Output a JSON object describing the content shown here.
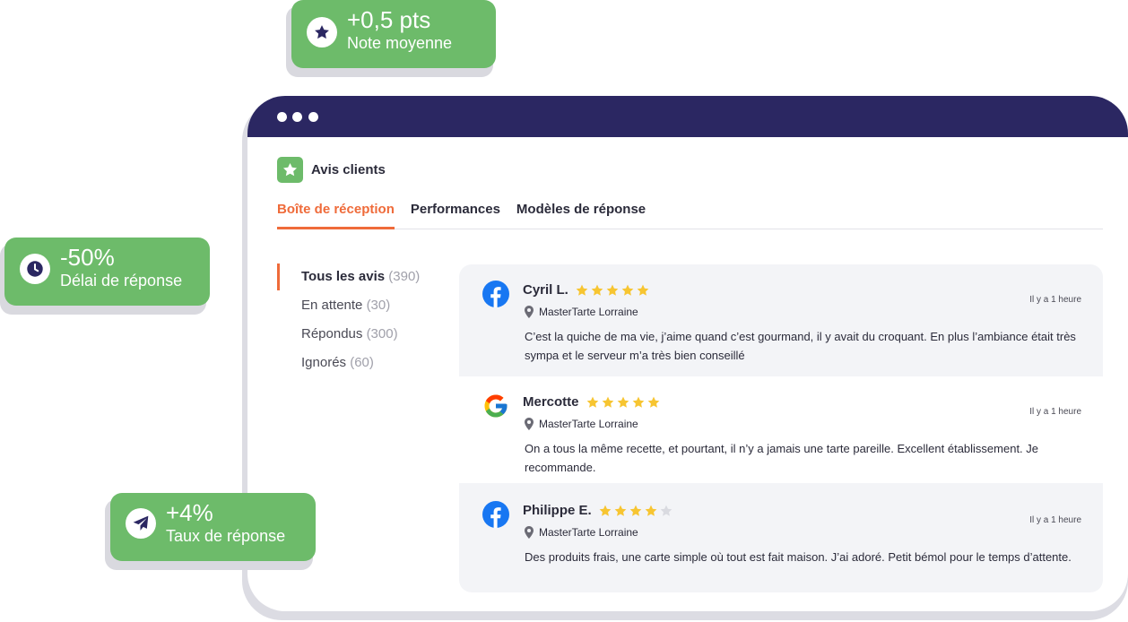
{
  "app": {
    "title": "Avis clients"
  },
  "tabs": [
    {
      "label": "Boîte de réception",
      "active": true
    },
    {
      "label": "Performances",
      "active": false
    },
    {
      "label": "Modèles de réponse",
      "active": false
    }
  ],
  "filters": [
    {
      "label": "Tous les avis",
      "count": "(390)",
      "active": true
    },
    {
      "label": "En attente",
      "count": "(30)",
      "active": false
    },
    {
      "label": "Répondus",
      "count": "(300)",
      "active": false
    },
    {
      "label": "Ignorés",
      "count": "(60)",
      "active": false
    }
  ],
  "reviews": [
    {
      "source": "facebook",
      "source_icon": "facebook-icon",
      "name": "Cyril L.",
      "rating": 5,
      "time": "Il y a 1 heure",
      "location": "MasterTarte Lorraine",
      "text": "C’est la quiche de ma vie, j’aime quand c’est gourmand, il y avait du croquant. En plus l’ambiance était très sympa et le serveur m’a très bien conseillé"
    },
    {
      "source": "google",
      "source_icon": "google-icon",
      "name": "Mercotte",
      "rating": 5,
      "time": "Il y a 1 heure",
      "location": "MasterTarte Lorraine",
      "text": "On a tous la même recette, et pourtant, il n’y a jamais une tarte pareille. Excellent établissement. Je recommande."
    },
    {
      "source": "facebook",
      "source_icon": "facebook-icon",
      "name": "Philippe E.",
      "rating": 4,
      "time": "Il y a 1 heure",
      "location": "MasterTarte Lorraine",
      "text": "Des produits frais, une carte simple où tout est fait maison. J’ai adoré. Petit bémol pour le temps d’attente."
    }
  ],
  "badges": {
    "rating": {
      "value": "+0,5 pts",
      "label": "Note moyenne",
      "icon": "star-icon"
    },
    "delay": {
      "value": "-50%",
      "label": "Délai de réponse",
      "icon": "clock-icon"
    },
    "rate": {
      "value": "+4%",
      "label": "Taux de réponse",
      "icon": "paper-plane-icon"
    }
  },
  "colors": {
    "titlebar": "#2b2762",
    "accent": "#ef6b3a",
    "badge_green": "#6dbb6a",
    "star_filled": "#f7c531",
    "star_empty": "#d9dae0",
    "facebook_blue": "#1877f2"
  }
}
